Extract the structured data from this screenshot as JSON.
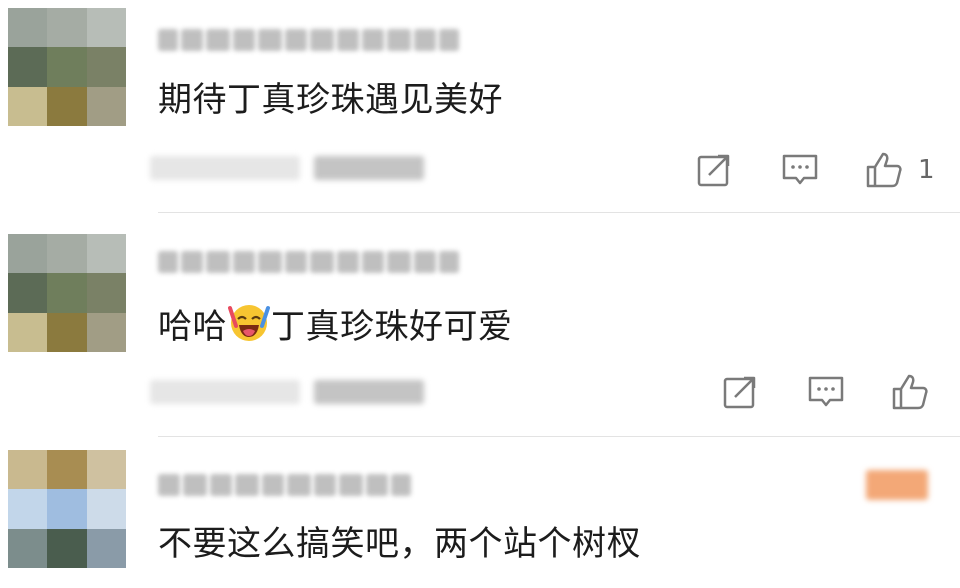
{
  "comments": [
    {
      "text": "期待丁真珍珠遇见美好",
      "like_count": "1",
      "has_badge": false
    },
    {
      "text_before_emoji": "哈哈",
      "emoji": "laughing-crying-emoji",
      "text_after_emoji": "丁真珍珠好可爱",
      "like_count": "",
      "has_badge": false
    },
    {
      "text": "不要这么搞笑吧，两个站个树杈",
      "has_badge": true
    }
  ],
  "icons": {
    "share": "share-icon",
    "reply": "comment-icon",
    "like": "thumbs-up-icon"
  },
  "colors": {
    "text": "#1c1c1c",
    "icon": "#7a7a7a",
    "divider": "#e3e3e3",
    "badge": "#f3a877"
  }
}
